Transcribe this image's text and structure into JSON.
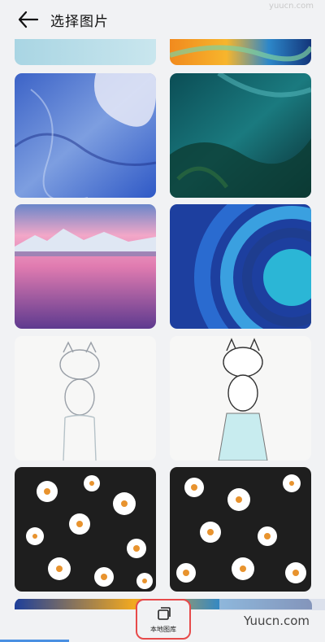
{
  "header": {
    "back_icon": "arrow-left-icon",
    "title": "选择图片",
    "watermark": "yuucn.com"
  },
  "gallery": {
    "tiles": [
      "sky-blue-strip",
      "orange-blue-wave",
      "blue-ink-abstract",
      "teal-fabric-abstract",
      "pink-sunset-lake-iceberg",
      "blue-swirl-rings",
      "cat-sketch-on-bottle",
      "cat-sketch-on-bottle-colored",
      "daisies-dark-background",
      "daisies-dark-background-2"
    ]
  },
  "bottom": {
    "local_gallery_label": "本地图库",
    "local_gallery_icon": "gallery-icon",
    "brand_text": "Yuucn.com"
  },
  "colors": {
    "accent": "#e74a4a",
    "background": "#f1f2f4"
  }
}
